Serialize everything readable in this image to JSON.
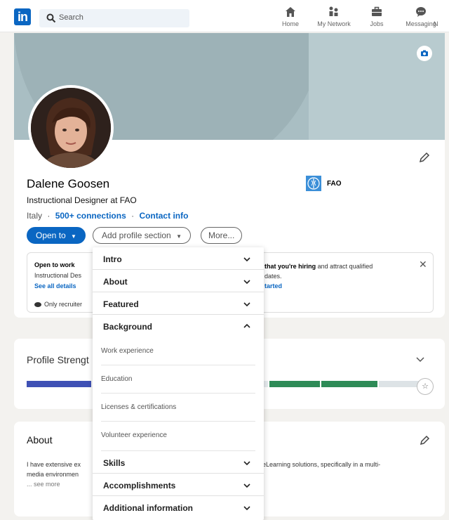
{
  "nav": {
    "logo": "in",
    "search_placeholder": "Search",
    "items": [
      {
        "label": "Home",
        "icon": "home-icon"
      },
      {
        "label": "My Network",
        "icon": "network-icon"
      },
      {
        "label": "Jobs",
        "icon": "briefcase-icon"
      },
      {
        "label": "Messaging",
        "icon": "messaging-icon"
      },
      {
        "label": "N",
        "icon": "notifications-icon"
      }
    ]
  },
  "profile": {
    "name": "Dalene Goosen",
    "headline": "Instructional Designer at FAO",
    "location": "Italy",
    "separator": "·",
    "connections": "500+ connections",
    "contact": "Contact info",
    "organization": "FAO"
  },
  "actions": {
    "open_to": "Open to",
    "add_section": "Add profile section",
    "more": "More..."
  },
  "open_to_work": {
    "title": "Open to work",
    "desc": "Instructional Des",
    "link": "See all details",
    "visibility": "Only recruiter",
    "hiring_bold": "that you're hiring",
    "hiring_text": " and attract qualified",
    "hiring_text2": "dates.",
    "hiring_link": "tarted",
    "close": "✕"
  },
  "strength": {
    "title": "Profile Strengt",
    "progress_level": 0.85
  },
  "about": {
    "title": "About",
    "text_left": "I have extensive ex",
    "text_right": "eLearning solutions, specifically in a multi-",
    "text_line2": "media environmen",
    "see_more": "... see more"
  },
  "dropdown": {
    "sections": [
      {
        "label": "Intro",
        "state": "collapsed"
      },
      {
        "label": "About",
        "state": "collapsed"
      },
      {
        "label": "Featured",
        "state": "collapsed"
      },
      {
        "label": "Background",
        "state": "expanded"
      },
      {
        "label": "Skills",
        "state": "collapsed"
      },
      {
        "label": "Accomplishments",
        "state": "collapsed"
      },
      {
        "label": "Additional information",
        "state": "collapsed"
      }
    ],
    "background_items": [
      "Work experience",
      "Education",
      "Licenses & certifications",
      "Volunteer experience"
    ]
  },
  "colors": {
    "brand": "#0a66c2",
    "progress_blue": "#3f51b5",
    "progress_green": "#2e8b57"
  }
}
